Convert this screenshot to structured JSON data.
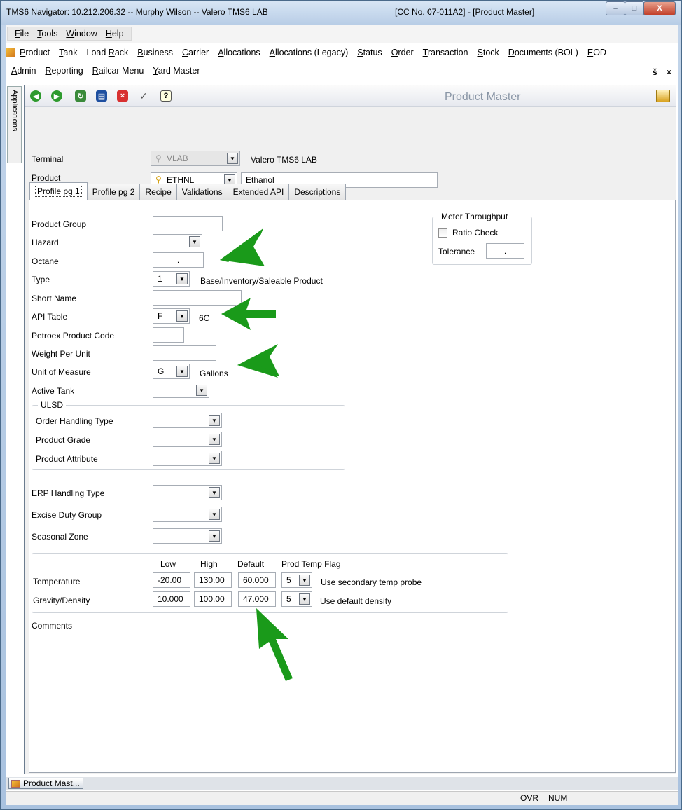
{
  "window": {
    "title_left": "TMS6 Navigator: 10.212.206.32 -- Murphy Wilson -- Valero TMS6 LAB",
    "title_right": "[CC No. 07-011A2] - [Product Master]",
    "controls": {
      "minimize": "–",
      "maximize": "□",
      "close": "X"
    }
  },
  "top_menu": [
    {
      "u": "F",
      "rest": "ile"
    },
    {
      "u": "T",
      "rest": "ools"
    },
    {
      "u": "W",
      "rest": "indow"
    },
    {
      "u": "H",
      "rest": "elp"
    }
  ],
  "app_menu_row1": [
    {
      "u": "P",
      "rest": "roduct"
    },
    {
      "u": "T",
      "rest": "ank"
    },
    {
      "pre": "Load ",
      "u": "R",
      "rest": "ack"
    },
    {
      "u": "B",
      "rest": "usiness"
    },
    {
      "u": "C",
      "rest": "arrier"
    },
    {
      "u": "A",
      "rest": "llocations"
    },
    {
      "u": "A",
      "rest": "llocations (Legacy)"
    },
    {
      "u": "S",
      "rest": "tatus"
    },
    {
      "u": "O",
      "rest": "rder"
    },
    {
      "u": "T",
      "rest": "ransaction"
    },
    {
      "u": "S",
      "rest": "tock"
    },
    {
      "u": "D",
      "rest": "ocuments (BOL)"
    },
    {
      "u": "E",
      "rest": "OD"
    }
  ],
  "app_menu_row2": [
    {
      "u": "A",
      "rest": "dmin"
    },
    {
      "u": "R",
      "rest": "eporting"
    },
    {
      "u": "R",
      "rest": "ailcar Menu"
    },
    {
      "u": "Y",
      "rest": "ard Master"
    }
  ],
  "mdi_controls": "_ š ×",
  "side_tab": "Applications",
  "toolbar": {
    "title": "Product Master"
  },
  "header": {
    "terminal_label": "Terminal",
    "terminal_code": "VLAB",
    "terminal_name": "Valero TMS6 LAB",
    "product_label": "Product",
    "product_code": "ETHNL",
    "product_name": "Ethanol"
  },
  "tabs": [
    "Profile pg 1",
    "Profile pg 2",
    "Recipe",
    "Validations",
    "Extended API",
    "Descriptions"
  ],
  "form": {
    "product_group_label": "Product Group",
    "product_group_value": "",
    "hazard_label": "Hazard",
    "hazard_value": "",
    "octane_label": "Octane",
    "octane_value": ".",
    "type_label": "Type",
    "type_value": "1",
    "type_desc": "Base/Inventory/Saleable Product",
    "short_name_label": "Short Name",
    "short_name_value": "",
    "api_table_label": "API Table",
    "api_table_value": "F",
    "api_table_desc": "6C",
    "petroex_label": "Petroex Product Code",
    "petroex_value": "",
    "weight_label": "Weight Per Unit",
    "weight_value": "",
    "uom_label": "Unit of Measure",
    "uom_value": "G",
    "uom_desc": "Gallons",
    "active_tank_label": "Active Tank",
    "active_tank_value": ""
  },
  "ulsd": {
    "title": "ULSD",
    "order_handling_label": "Order Handling Type",
    "product_grade_label": "Product Grade",
    "product_attribute_label": "Product Attribute"
  },
  "more": {
    "erp_label": "ERP Handling Type",
    "excise_label": "Excise Duty Group",
    "seasonal_label": "Seasonal Zone"
  },
  "meter": {
    "title": "Meter Throughput",
    "ratio_label": "Ratio Check",
    "tolerance_label": "Tolerance",
    "tolerance_value": "."
  },
  "temp_grid": {
    "headers": [
      "Low",
      "High",
      "Default",
      "Prod Temp Flag"
    ],
    "rows": [
      {
        "label": "Temperature",
        "low": "-20.00",
        "high": "130.00",
        "default": "60.000",
        "flag": "5",
        "desc": "Use secondary temp probe"
      },
      {
        "label": "Gravity/Density",
        "low": "10.000",
        "high": "100.00",
        "default": "47.000",
        "flag": "5",
        "desc": "Use default density"
      }
    ]
  },
  "comments_label": "Comments",
  "taskbar": {
    "item": "Product Mast..."
  },
  "status": {
    "ovr": "OVR",
    "num": "NUM"
  },
  "colors": {
    "arrow": "#1a9a1a",
    "title_gray": "#8a96a6"
  }
}
